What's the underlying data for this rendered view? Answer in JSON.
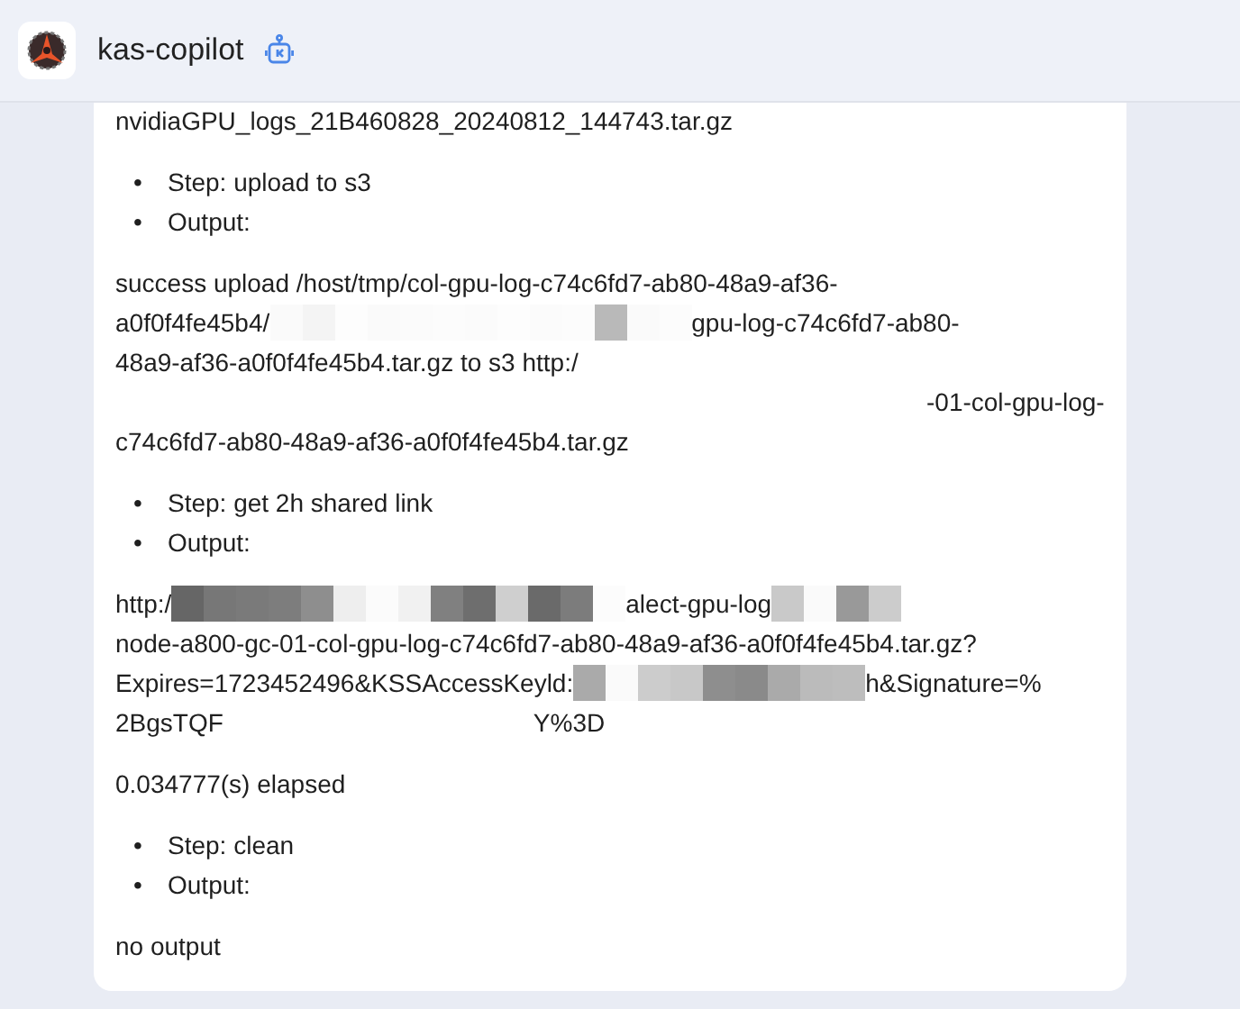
{
  "header": {
    "title": "kas-copilot"
  },
  "blocks": [
    {
      "kind": "paragraph",
      "lines": [
        {
          "segments": [
            {
              "kind": "text",
              "text": "nvidiaGPU_logs_21B460828_20240812_144743.tar.gz"
            }
          ]
        }
      ]
    },
    {
      "kind": "list",
      "items": [
        {
          "marker": "•",
          "text": "Step: upload to s3"
        },
        {
          "marker": "•",
          "text": "Output:"
        }
      ]
    },
    {
      "kind": "paragraph",
      "lines": [
        {
          "segments": [
            {
              "kind": "text",
              "text": "success upload /host/tmp/col-gpu-log-c74c6fd7-ab80-48a9-af36-"
            }
          ]
        },
        {
          "segments": [
            {
              "kind": "text",
              "text": "a0f0f4fe45b4/"
            },
            {
              "kind": "mask"
            },
            {
              "kind": "text",
              "text": "gpu-log-c74c6fd7-ab80-"
            }
          ]
        },
        {
          "segments": [
            {
              "kind": "text",
              "text": "48a9-af36-a0f0f4fe45b4.tar.gz to s3 http:/"
            }
          ]
        },
        {
          "segments": [
            {
              "kind": "gap"
            },
            {
              "kind": "text",
              "text": "-01-col-gpu-log-"
            }
          ]
        },
        {
          "segments": [
            {
              "kind": "text",
              "text": "c74c6fd7-ab80-48a9-af36-a0f0f4fe45b4.tar.gz"
            }
          ]
        }
      ]
    },
    {
      "kind": "list",
      "items": [
        {
          "marker": "•",
          "text": "Step: get 2h shared link"
        },
        {
          "marker": "•",
          "text": "Output:"
        }
      ]
    },
    {
      "kind": "paragraph",
      "lines": [
        {
          "segments": [
            {
              "kind": "text",
              "text": "http:/"
            },
            {
              "kind": "mask"
            },
            {
              "kind": "text",
              "text": "alect-gpu-log"
            },
            {
              "kind": "mask"
            }
          ]
        },
        {
          "segments": [
            {
              "kind": "text",
              "text": "node-a800-gc-01-col-gpu-log-c74c6fd7-ab80-48a9-af36-a0f0f4fe45b4.tar.gz?"
            }
          ]
        },
        {
          "segments": [
            {
              "kind": "text",
              "text": "Expires=1723452496&KSSAccessKeyld:"
            },
            {
              "kind": "mask"
            },
            {
              "kind": "text",
              "text": "h&Signature=%"
            }
          ]
        },
        {
          "segments": [
            {
              "kind": "text",
              "text": "2BgsTQF"
            },
            {
              "kind": "gap"
            },
            {
              "kind": "text",
              "text": "Y%3D"
            }
          ]
        }
      ]
    },
    {
      "kind": "paragraph",
      "lines": [
        {
          "segments": [
            {
              "kind": "text",
              "text": "0.034777(s) elapsed"
            }
          ]
        }
      ]
    },
    {
      "kind": "list",
      "items": [
        {
          "marker": "•",
          "text": "Step: clean"
        },
        {
          "marker": "•",
          "text": "Output:"
        }
      ]
    },
    {
      "kind": "paragraph",
      "lines": [
        {
          "segments": [
            {
              "kind": "text",
              "text": "no output"
            }
          ]
        }
      ]
    }
  ]
}
